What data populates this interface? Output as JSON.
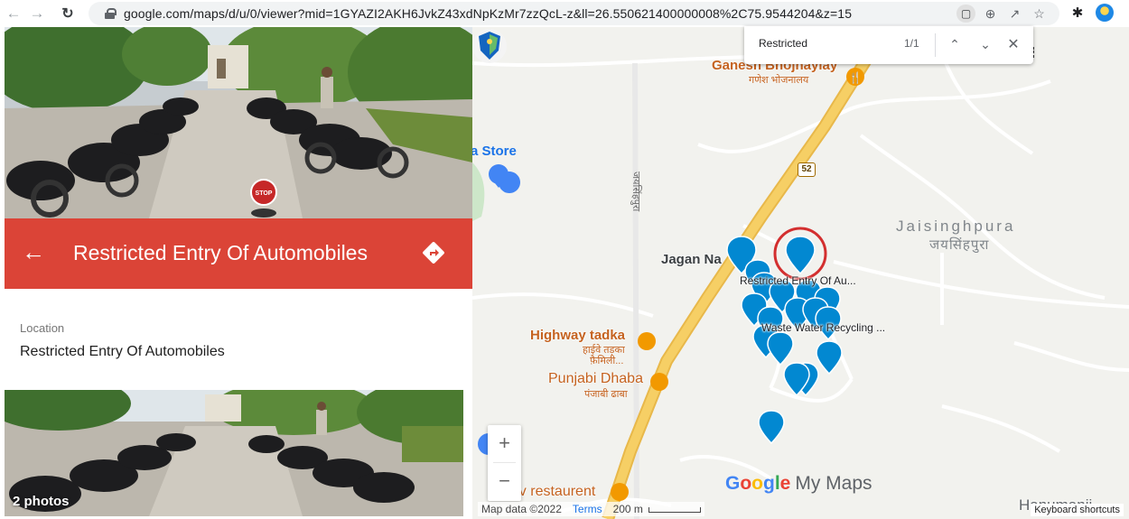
{
  "browser": {
    "url": "google.com/maps/d/u/0/viewer?mid=1GYAZI2AKH6JvkZ43xdNpKzMr7zzQcL-z&ll=26.550621400000008%2C75.9544204&z=15"
  },
  "find_bar": {
    "query": "Restricted",
    "count": "1/1"
  },
  "panel": {
    "title": "Restricted Entry Of Automobiles",
    "location_label": "Location",
    "location_value": "Restricted Entry Of Automobiles",
    "photo_count": "2 photos",
    "hero_sign_text": "STOP"
  },
  "map": {
    "labels": {
      "ganesh_en": "Ganesh Bhojnaylay",
      "ganesh_hi": "गणेश भोजनालय",
      "store": "a Store",
      "road_hi": "जयसिंहपुरा",
      "jaisinghpura_en": "Jaisinghpura",
      "jaisinghpura_hi": "जयसिंहपुरा",
      "jagan": "Jagan Na",
      "highway_en": "Highway tadka",
      "highway_hi": "हाईवे तड़का",
      "highway_hi2": "फ़ैमिली...",
      "punjabi_en": "Punjabi Dhaba",
      "punjabi_hi": "पंजाबी ढाबा",
      "dev": "dev restaurent",
      "partial_bottom": "Hanumanji..."
    },
    "route_number": "52",
    "marker_labels": {
      "restricted": "Restricted Entry Of Au...",
      "waste": "Waste Water Recycling ..."
    },
    "zoom_in": "+",
    "zoom_out": "−",
    "logo": {
      "g": "G",
      "o1": "o",
      "o2": "o",
      "g2": "g",
      "l": "l",
      "e": "e",
      "suffix": "My Maps"
    },
    "attribution": {
      "map_data": "Map data ©2022",
      "terms": "Terms",
      "scale": "200 m"
    },
    "keyboard_shortcuts": "Keyboard shortcuts"
  },
  "colors": {
    "header_red": "#db4437",
    "marker_blue": "#0288d1",
    "road_yellow": "#f6cf65",
    "highlight_circle": "#d32f2f"
  }
}
